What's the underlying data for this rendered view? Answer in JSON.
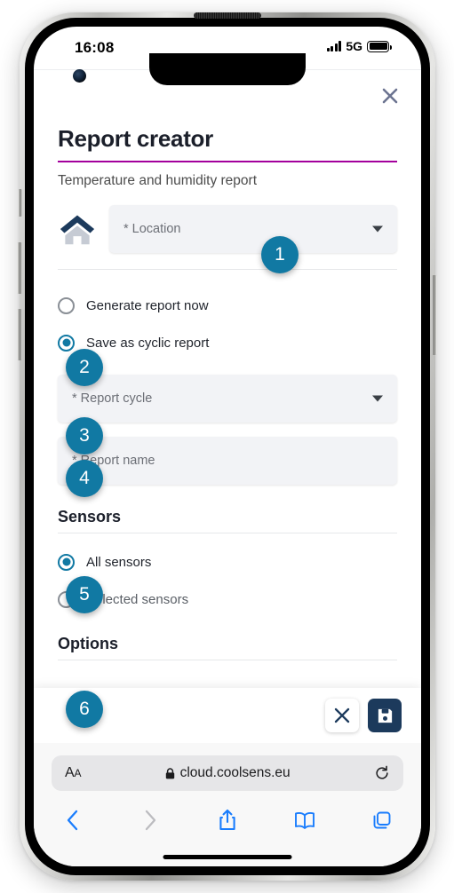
{
  "status_bar": {
    "time": "16:08",
    "network": "5G",
    "signal_icon": "signal-bars-icon",
    "battery_icon": "battery-full-icon"
  },
  "page": {
    "close_icon": "close-x-icon",
    "title": "Report creator",
    "subtitle": "Temperature and humidity report",
    "accent_color": "#a3009c",
    "location": {
      "icon": "home-icon",
      "placeholder": "* Location",
      "value": "",
      "dropdown_icon": "chevron-down-icon"
    },
    "mode_options": [
      {
        "label": "Generate report now",
        "selected": false
      },
      {
        "label": "Save as cyclic report",
        "selected": true
      }
    ],
    "report_cycle": {
      "placeholder": "* Report cycle",
      "value": "",
      "dropdown_icon": "chevron-down-icon"
    },
    "report_name": {
      "placeholder": "* Report name",
      "value": ""
    },
    "sensors": {
      "heading": "Sensors",
      "options": [
        {
          "label": "All sensors",
          "selected": true
        },
        {
          "label": "Selected sensors",
          "selected": false
        }
      ]
    },
    "options_heading": "Options",
    "actions": {
      "cancel_icon": "close-x-icon",
      "save_icon": "save-floppy-icon",
      "save_bg": "#1c3a5c"
    }
  },
  "browser": {
    "text_size_label": "AA",
    "lock_icon": "lock-icon",
    "url": "cloud.coolsens.eu",
    "reload_icon": "reload-icon",
    "nav": [
      {
        "name": "back",
        "icon": "chevron-left-icon",
        "enabled": true
      },
      {
        "name": "forward",
        "icon": "chevron-right-icon",
        "enabled": false
      },
      {
        "name": "share",
        "icon": "share-icon",
        "enabled": true
      },
      {
        "name": "bookmarks",
        "icon": "book-icon",
        "enabled": true
      },
      {
        "name": "tabs",
        "icon": "tabs-icon",
        "enabled": true
      }
    ]
  },
  "callouts": [
    {
      "number": "1",
      "target": "location-field"
    },
    {
      "number": "2",
      "target": "save-as-cyclic-report-radio"
    },
    {
      "number": "3",
      "target": "report-cycle-field"
    },
    {
      "number": "4",
      "target": "report-name-field"
    },
    {
      "number": "5",
      "target": "all-sensors-radio"
    },
    {
      "number": "6",
      "target": "options-section"
    }
  ]
}
